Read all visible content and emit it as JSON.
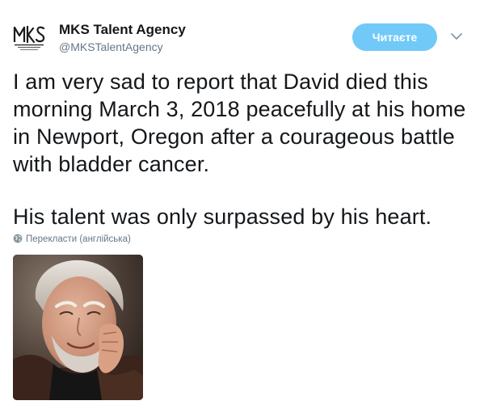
{
  "tweet": {
    "display_name": "MKS Talent Agency",
    "handle": "@MKSTalentAgency",
    "avatar": {
      "logo_text": "MKS",
      "logo_tagline": "& ASSOCIATES"
    },
    "follow_label": "Читаєте",
    "paragraphs": [
      "I am very sad to report that David died this morning March 3, 2018 peacefully at his home in Newport, Oregon after a courageous battle with bladder cancer.",
      "His talent was only surpassed by his heart."
    ],
    "translate_label": "Перекласти (англійська)",
    "media": {
      "icon": "photo-of-smiling-elderly-man"
    }
  },
  "icons": {
    "caret": "chevron-down-icon",
    "globe": "globe-icon"
  },
  "colors": {
    "follow_button_bg": "#71c9f8",
    "text_primary": "#14171a",
    "text_secondary": "#657786"
  }
}
